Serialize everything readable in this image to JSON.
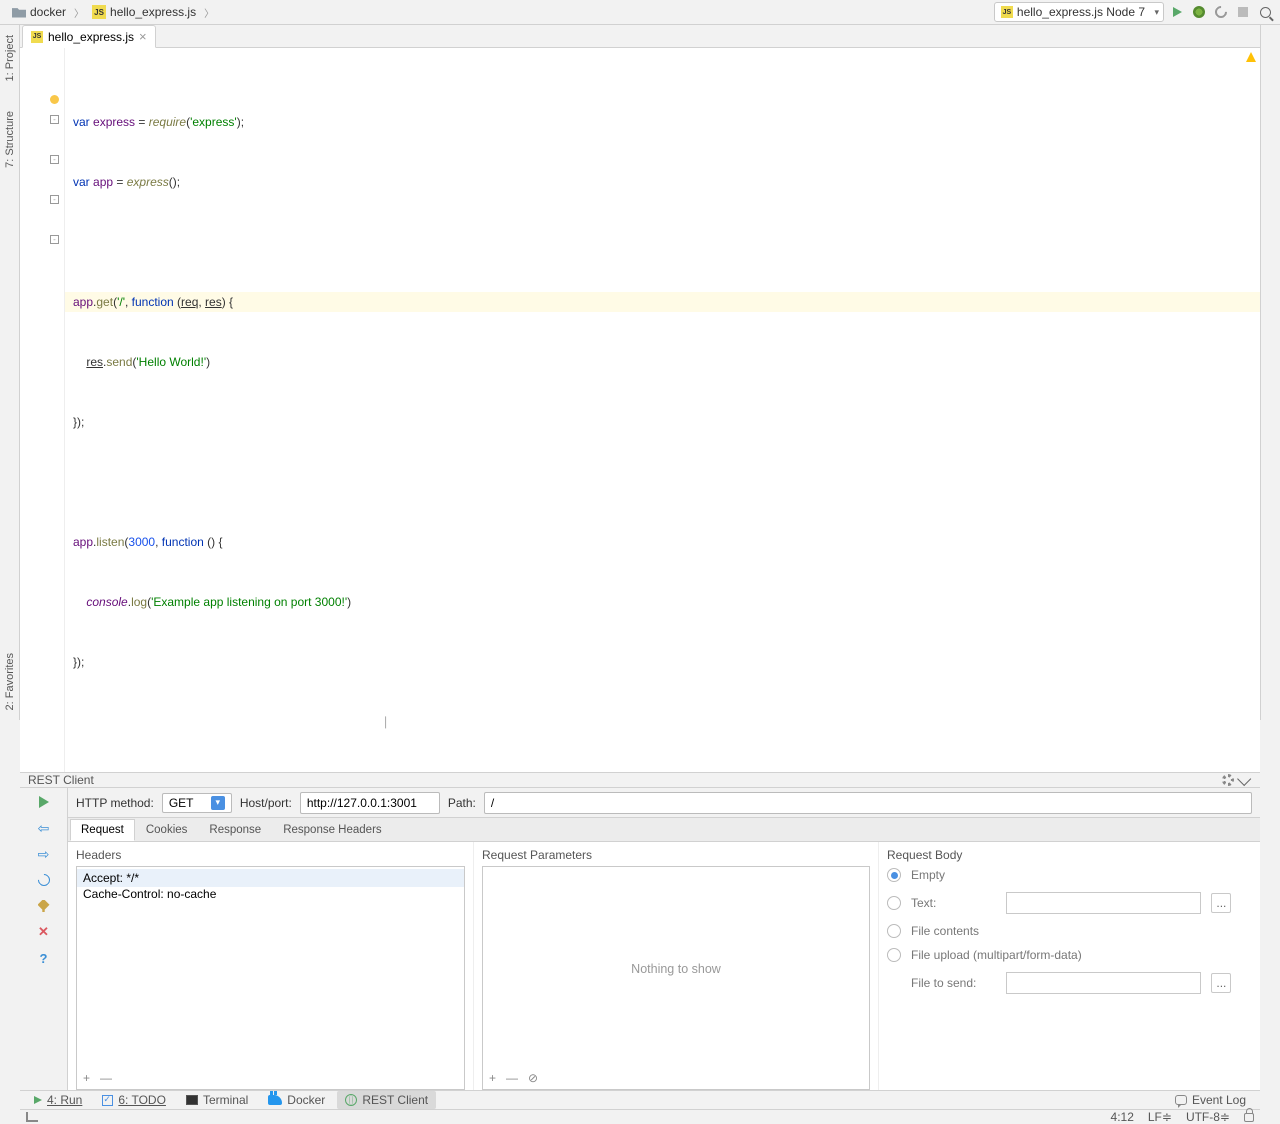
{
  "breadcrumb": {
    "folder": "docker",
    "file": "hello_express.js"
  },
  "runConfig": "hello_express.js Node 7",
  "tab": {
    "name": "hello_express.js"
  },
  "code": {
    "l1": {
      "a": "var ",
      "b": "express",
      "c": " = ",
      "d": "require",
      "e": "(",
      "f": "'express'",
      "g": ");"
    },
    "l2": {
      "a": "var ",
      "b": "app",
      "c": " = ",
      "d": "express",
      "e": "();"
    },
    "l3": {
      "a": "app",
      "b": ".",
      "c": "get",
      "d": "(",
      "e": "'/'",
      "f": ", ",
      "g": "function ",
      "h": "(",
      "i": "req",
      "j": ", ",
      "k": "res",
      "l": ") {"
    },
    "l4": {
      "a": "    ",
      "b": "res",
      "c": ".",
      "d": "send",
      "e": "(",
      "f": "'Hello World!'",
      "g": ")"
    },
    "l5": "});",
    "l6": {
      "a": "app",
      "b": ".",
      "c": "listen",
      "d": "(",
      "e": "3000",
      "f": ", ",
      "g": "function ",
      "h": "() {"
    },
    "l7": {
      "a": "    ",
      "b": "console",
      "c": ".",
      "d": "log",
      "e": "(",
      "f": "'Example app listening on port 3000!'",
      "g": ")"
    },
    "l8": "});"
  },
  "panel": {
    "title": "REST Client"
  },
  "rest": {
    "methodLabel": "HTTP method:",
    "methodValue": "GET",
    "hostLabel": "Host/port:",
    "hostValue": "http://127.0.0.1:3001",
    "pathLabel": "Path:",
    "pathValue": "/",
    "tabs": {
      "request": "Request",
      "cookies": "Cookies",
      "response": "Response",
      "responseHeaders": "Response Headers"
    },
    "headersTitle": "Headers",
    "headers": {
      "l1": "Accept: */*",
      "l2": "Cache-Control: no-cache"
    },
    "paramsTitle": "Request Parameters",
    "nothing": "Nothing to show",
    "bodyTitle": "Request Body",
    "body": {
      "empty": "Empty",
      "text": "Text:",
      "file": "File contents",
      "upload": "File upload (multipart/form-data)",
      "fileToSend": "File to send:"
    },
    "add": "+",
    "remove": "—",
    "clear": "⊘",
    "dots": "..."
  },
  "bottomTabs": {
    "run": "4: Run",
    "todo": "6: TODO",
    "terminal": "Terminal",
    "docker": "Docker",
    "rest": "REST Client",
    "eventLog": "Event Log"
  },
  "status": {
    "pos": "4:12",
    "le": "LF≑",
    "enc": "UTF-8≑"
  },
  "sideTools": {
    "project": "1: Project",
    "structure": "7: Structure",
    "favorites": "2: Favorites"
  }
}
